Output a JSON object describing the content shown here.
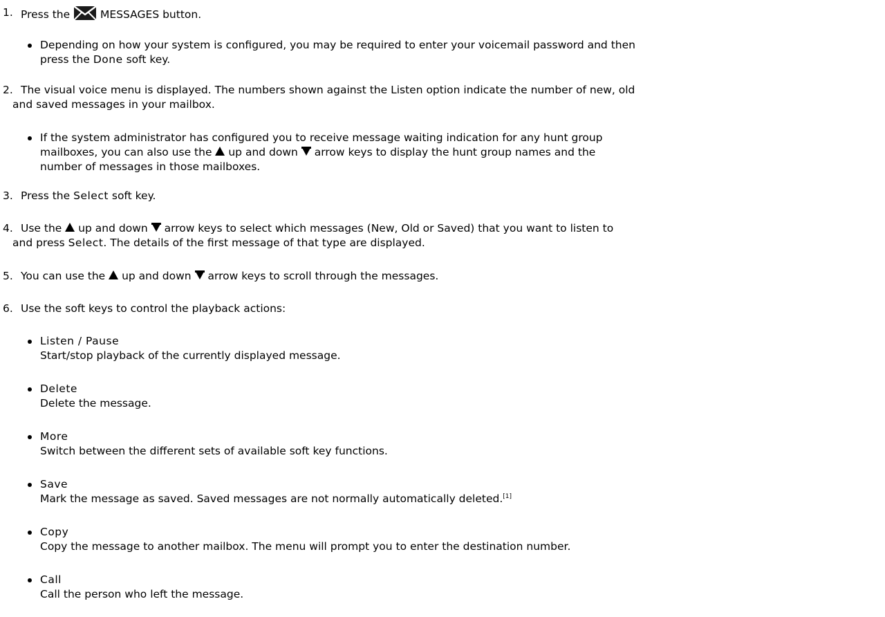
{
  "steps": [
    {
      "num": "1.",
      "pre": "Press the",
      "post": "MESSAGES button."
    },
    {
      "num": "2.",
      "l1": "The visual voice menu is displayed. The numbers shown against the Listen option indicate the number of new, old",
      "l2": "and saved messages in your mailbox."
    },
    {
      "num": "3.",
      "pre": "Press the",
      "kw": "Select",
      "post": "soft key."
    },
    {
      "num": "4.",
      "a": "Use the",
      "b": "up and down",
      "c": "arrow keys to select which messages (New, Old or Saved) that you want to listen to",
      "d": "and press",
      "kw": "Select",
      "e": ". The details of the first message of that type are displayed."
    },
    {
      "num": "5.",
      "a": "You can use the",
      "b": "up and down",
      "c": "arrow keys to scroll through the messages."
    },
    {
      "num": "6.",
      "text": "Use the soft keys to control the playback actions:"
    }
  ],
  "bullet1": {
    "l1": "Depending on how your system is configured, you may be required to enter your voicemail password and then",
    "pre": "press the",
    "kw": "Done",
    "post": "soft key."
  },
  "bullet2": {
    "l1": "If the system administrator has configured you to receive message waiting indication for any hunt group",
    "a": "mailboxes, you can also use the",
    "b": "up and down",
    "c": "arrow keys to display the hunt group names and the",
    "l3": "number of messages in those mailboxes."
  },
  "soft_keys": [
    {
      "name": "Listen / Pause",
      "desc": "Start/stop playback of the currently displayed message."
    },
    {
      "name": "Delete",
      "desc": "Delete the message."
    },
    {
      "name": "More",
      "desc": "Switch between the different sets of available soft key functions."
    },
    {
      "name": "Save",
      "desc": "Mark the message as saved. Saved messages are not normally automatically deleted.",
      "footnote": "[1]"
    },
    {
      "name": "Copy",
      "desc": "Copy the message to another mailbox. The menu will prompt you to enter the destination number."
    },
    {
      "name": "Call",
      "desc": "Call the person who left the message."
    }
  ],
  "icons": {
    "messages": "envelope-icon",
    "up": "up-arrow-icon",
    "down": "down-arrow-icon"
  }
}
